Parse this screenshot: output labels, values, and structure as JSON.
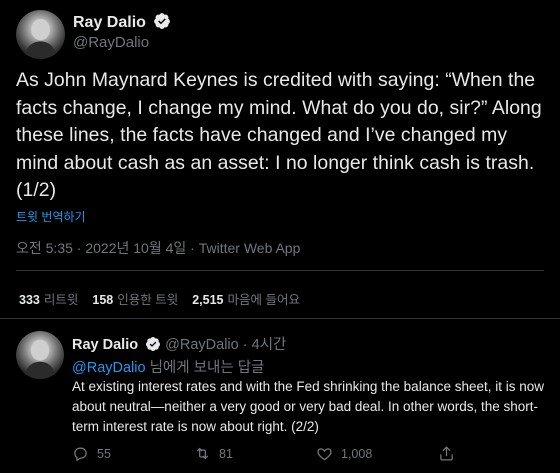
{
  "tweet": {
    "author_name": "Ray Dalio",
    "author_handle": "@RayDalio",
    "text": "As John Maynard Keynes is credited with saying: “When the facts change, I change my mind. What do you do, sir?” Along these lines, the facts have changed and I’ve changed my mind about cash as an asset: I no longer think cash is trash. (1/2)",
    "translate_label": "트윗 번역하기",
    "meta": "오전 5:35 · 2022년 10월 4일 · Twitter Web App"
  },
  "stats": {
    "retweets_count": "333",
    "retweets_label": "리트윗",
    "quotes_count": "158",
    "quotes_label": "인용한 트윗",
    "likes_count": "2,515",
    "likes_label": "마음에 들어요"
  },
  "reply": {
    "author_name": "Ray Dalio",
    "author_handle": "@RayDalio",
    "separator": "·",
    "time": "4시간",
    "reply_to_handle": "@RayDalio",
    "reply_to_suffix": "님에게 보내는 답글",
    "text": "At existing interest rates and with the Fed shrinking the balance sheet, it is now about neutral—neither a very good or very bad deal. In other words, the short-term interest rate is now about right. (2/2)",
    "actions": {
      "reply_count": "55",
      "retweet_count": "81",
      "like_count": "1,008"
    }
  },
  "colors": {
    "background": "#000000",
    "text": "#e7e9ea",
    "muted": "#71767b",
    "accent": "#1d9bf0",
    "divider": "#2f3336"
  },
  "icons": [
    "verified-badge-icon",
    "reply-icon",
    "retweet-icon",
    "like-icon",
    "share-icon"
  ]
}
